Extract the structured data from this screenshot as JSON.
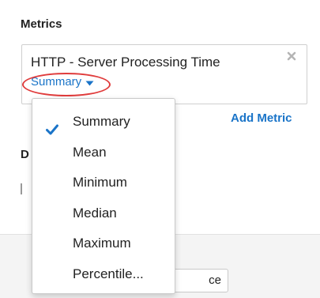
{
  "metrics_section": {
    "title": "Metrics"
  },
  "metric_card": {
    "name": "HTTP - Server Processing Time",
    "aggregation_label": "Summary",
    "remove_icon": "close-x-icon",
    "caret_icon": "caret-down-icon"
  },
  "add_metric_label": "Add Metric",
  "hidden_heading": "D",
  "obscured_button_label": "ce",
  "aggregation_menu": {
    "check_icon": "checkmark-icon",
    "selected_index": 0,
    "options": [
      {
        "label": "Summary",
        "selected": true
      },
      {
        "label": "Mean",
        "selected": false
      },
      {
        "label": "Minimum",
        "selected": false
      },
      {
        "label": "Median",
        "selected": false
      },
      {
        "label": "Maximum",
        "selected": false
      },
      {
        "label": "Percentile...",
        "selected": false
      }
    ]
  },
  "colors": {
    "link": "#1a74c8",
    "highlight": "#e03c3c",
    "text": "#222222",
    "footer": "#f4f4f4"
  }
}
